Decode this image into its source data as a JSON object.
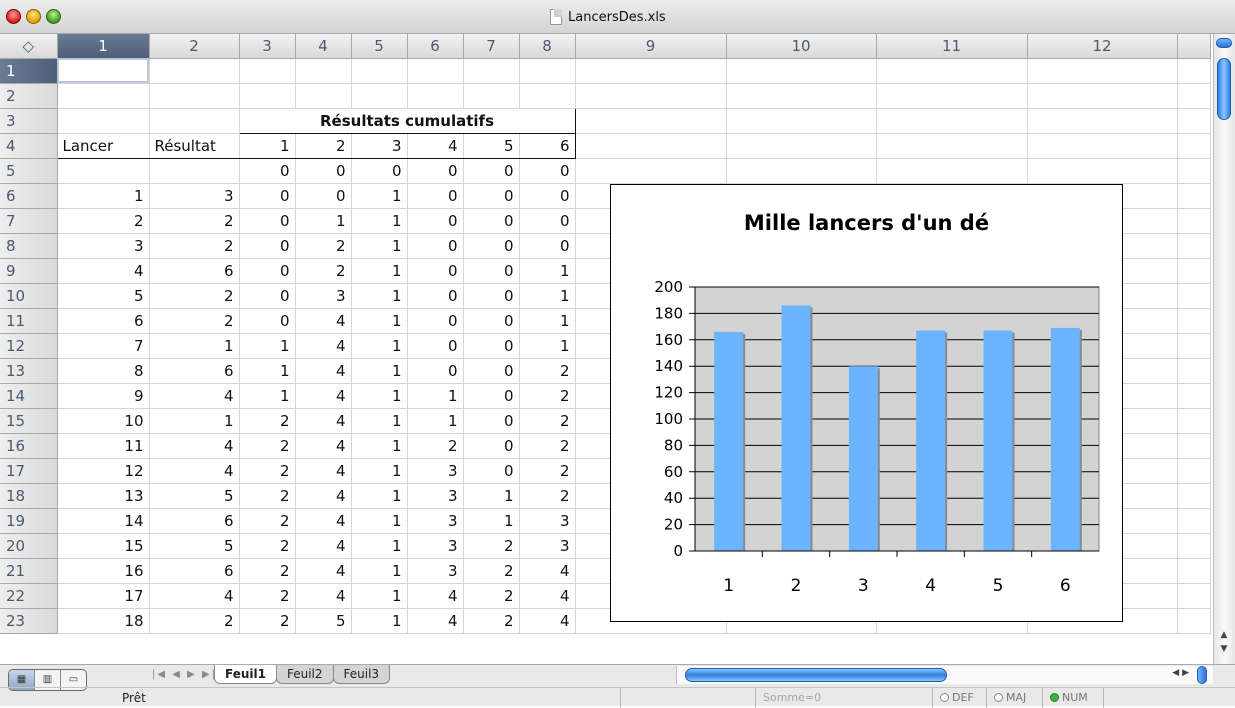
{
  "window": {
    "title": "LancersDes.xls"
  },
  "columns": [
    "1",
    "2",
    "3",
    "4",
    "5",
    "6",
    "7",
    "8",
    "9",
    "10",
    "11",
    "12"
  ],
  "rows": [
    "1",
    "2",
    "3",
    "4",
    "5",
    "6",
    "7",
    "8",
    "9",
    "10",
    "11",
    "12",
    "13",
    "14",
    "15",
    "16",
    "17",
    "18",
    "19",
    "20",
    "21",
    "22",
    "23"
  ],
  "table": {
    "group_header": "Résultats cumulatifs",
    "col_lancer": "Lancer",
    "col_resultat": "Résultat",
    "face_headers": [
      "1",
      "2",
      "3",
      "4",
      "5",
      "6"
    ],
    "initial_row": [
      "0",
      "0",
      "0",
      "0",
      "0",
      "0"
    ],
    "data_rows": [
      [
        "1",
        "3",
        "0",
        "0",
        "1",
        "0",
        "0",
        "0"
      ],
      [
        "2",
        "2",
        "0",
        "1",
        "1",
        "0",
        "0",
        "0"
      ],
      [
        "3",
        "2",
        "0",
        "2",
        "1",
        "0",
        "0",
        "0"
      ],
      [
        "4",
        "6",
        "0",
        "2",
        "1",
        "0",
        "0",
        "1"
      ],
      [
        "5",
        "2",
        "0",
        "3",
        "1",
        "0",
        "0",
        "1"
      ],
      [
        "6",
        "2",
        "0",
        "4",
        "1",
        "0",
        "0",
        "1"
      ],
      [
        "7",
        "1",
        "1",
        "4",
        "1",
        "0",
        "0",
        "1"
      ],
      [
        "8",
        "6",
        "1",
        "4",
        "1",
        "0",
        "0",
        "2"
      ],
      [
        "9",
        "4",
        "1",
        "4",
        "1",
        "1",
        "0",
        "2"
      ],
      [
        "10",
        "1",
        "2",
        "4",
        "1",
        "1",
        "0",
        "2"
      ],
      [
        "11",
        "4",
        "2",
        "4",
        "1",
        "2",
        "0",
        "2"
      ],
      [
        "12",
        "4",
        "2",
        "4",
        "1",
        "3",
        "0",
        "2"
      ],
      [
        "13",
        "5",
        "2",
        "4",
        "1",
        "3",
        "1",
        "2"
      ],
      [
        "14",
        "6",
        "2",
        "4",
        "1",
        "3",
        "1",
        "3"
      ],
      [
        "15",
        "5",
        "2",
        "4",
        "1",
        "3",
        "2",
        "3"
      ],
      [
        "16",
        "6",
        "2",
        "4",
        "1",
        "3",
        "2",
        "4"
      ],
      [
        "17",
        "4",
        "2",
        "4",
        "1",
        "4",
        "2",
        "4"
      ],
      [
        "18",
        "2",
        "2",
        "5",
        "1",
        "4",
        "2",
        "4"
      ]
    ]
  },
  "chart_data": {
    "type": "bar",
    "title": "Mille lancers d'un dé",
    "categories": [
      "1",
      "2",
      "3",
      "4",
      "5",
      "6"
    ],
    "values": [
      166,
      186,
      140,
      167,
      167,
      169
    ],
    "ylim": [
      0,
      200
    ],
    "yticks": [
      "0",
      "20",
      "40",
      "60",
      "80",
      "100",
      "120",
      "140",
      "160",
      "180",
      "200"
    ],
    "grid": true,
    "bar_color": "#6cb4ff",
    "plot_bg": "#d3d3d3"
  },
  "sheets": [
    "Feuil1",
    "Feuil2",
    "Feuil3"
  ],
  "active_sheet": "Feuil1",
  "status": {
    "ready": "Prêt",
    "sum": "Somme=0",
    "indicators": [
      {
        "label": "DEF",
        "on": false
      },
      {
        "label": "MAJ",
        "on": false
      },
      {
        "label": "NUM",
        "on": true
      }
    ]
  }
}
